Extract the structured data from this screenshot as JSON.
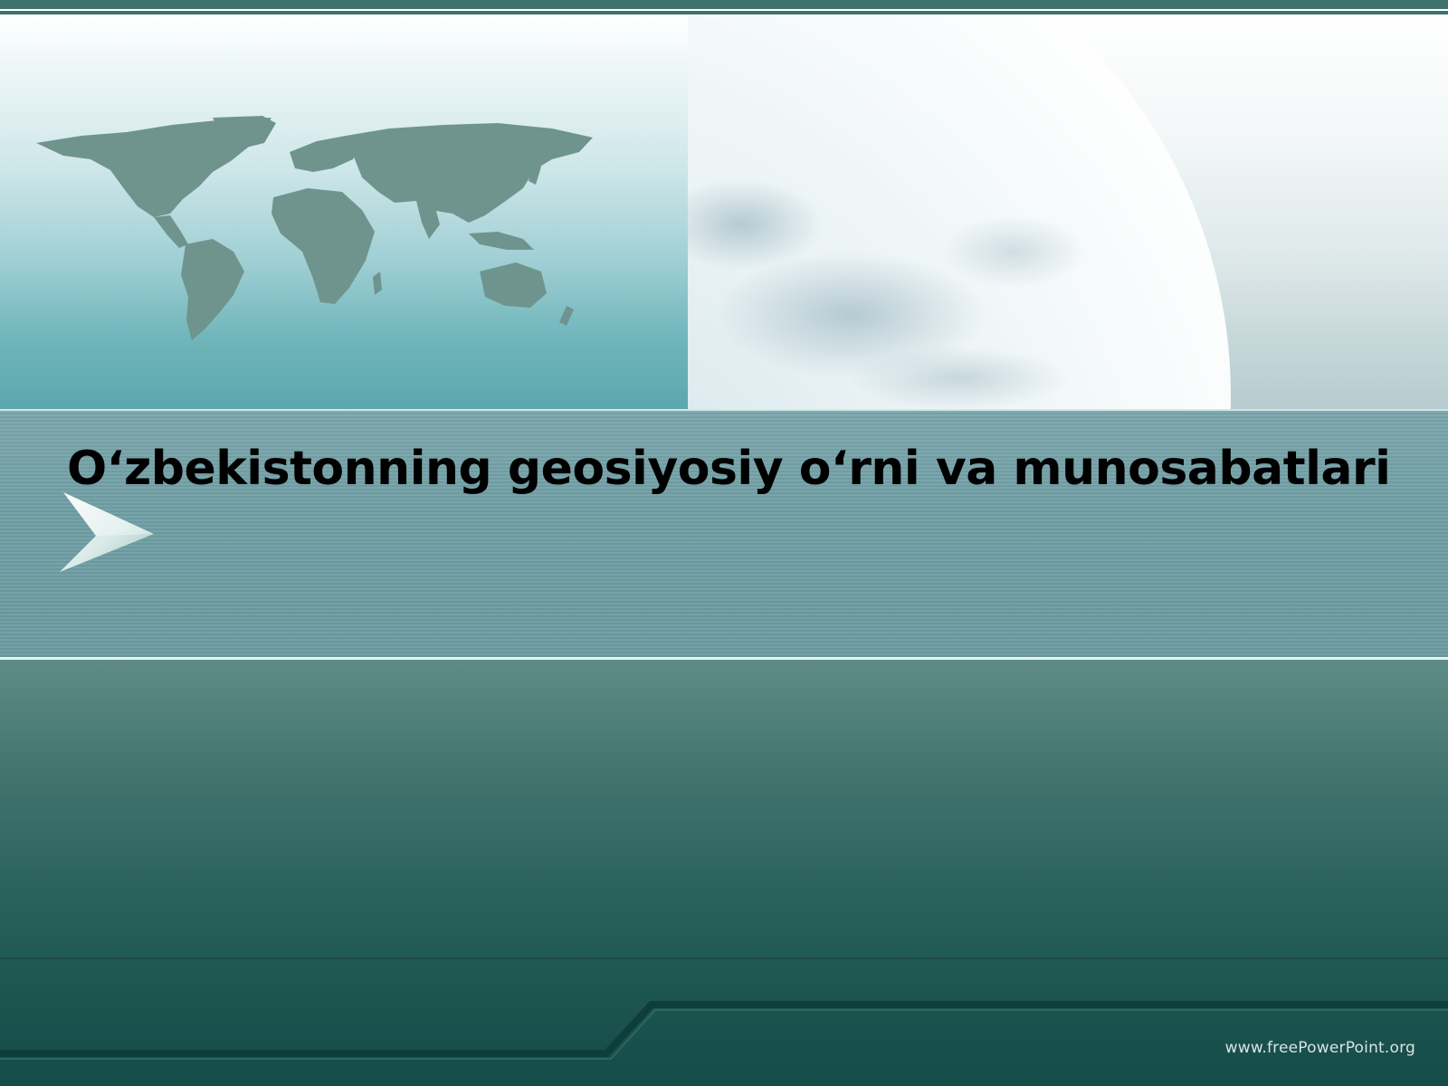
{
  "slide": {
    "title": "O‘zbekistonning geosiyosiy o‘rni va munosabatlari",
    "footer_url": "www.freePowerPoint.org"
  },
  "theme": {
    "accent": "#3f726c",
    "band": "#6f9ea4",
    "map_color": "#6f948e",
    "footer_text": "#d6e4e2"
  },
  "icons": {
    "arrow": "chevron-right-icon",
    "map": "world-map-icon",
    "globe": "globe-icon"
  }
}
